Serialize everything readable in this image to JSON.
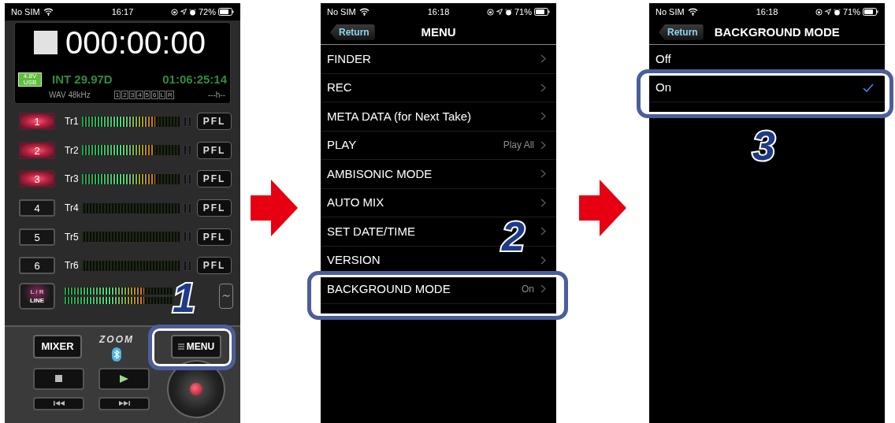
{
  "recorder_screen": {
    "status_bar": {
      "carrier": "No SIM",
      "time": "16:17",
      "battery": "72%"
    },
    "counter": "000:00:00",
    "power_badge": [
      "4.8V",
      "USB"
    ],
    "timecode_mode": "INT 29.97D",
    "timecode": "01:06:25:14",
    "file_format": "WAV 48kHz",
    "track_indicators": [
      "1",
      "2",
      "3",
      "4",
      "5",
      "6",
      "L",
      "R"
    ],
    "remaining_time": "---h--",
    "tracks": [
      {
        "number": "1",
        "label": "Tr1",
        "armed": true,
        "level": 0.75,
        "pfl": "PFL"
      },
      {
        "number": "2",
        "label": "Tr2",
        "armed": true,
        "level": 0.73,
        "pfl": "PFL"
      },
      {
        "number": "3",
        "label": "Tr3",
        "armed": true,
        "level": 0.75,
        "pfl": "PFL"
      },
      {
        "number": "4",
        "label": "Tr4",
        "armed": false,
        "level": 0,
        "pfl": "PFL"
      },
      {
        "number": "5",
        "label": "Tr5",
        "armed": false,
        "level": 0,
        "pfl": "PFL"
      },
      {
        "number": "6",
        "label": "Tr6",
        "armed": false,
        "level": 0,
        "pfl": "PFL"
      }
    ],
    "mix": {
      "label": "L / R",
      "sublabel": "LINE",
      "meters": [
        {
          "level": 0.73
        },
        {
          "level": 0.73
        }
      ]
    },
    "mixer_button": "MIXER",
    "logo": "ZOOM",
    "menu_button": "MENU"
  },
  "menu_screen": {
    "status_bar": {
      "carrier": "No SIM",
      "time": "16:18",
      "battery": "71%"
    },
    "back_button": "Return",
    "title": "MENU",
    "items": [
      {
        "label": "FINDER"
      },
      {
        "label": "REC"
      },
      {
        "label": "META DATA (for Next Take)"
      },
      {
        "label": "PLAY",
        "value": "Play All"
      },
      {
        "label": "AMBISONIC MODE"
      },
      {
        "label": "AUTO MIX"
      },
      {
        "label": "SET DATE/TIME"
      },
      {
        "label": "VERSION"
      },
      {
        "label": "BACKGROUND MODE",
        "value": "On"
      }
    ]
  },
  "background_mode_screen": {
    "status_bar": {
      "carrier": "No SIM",
      "time": "16:18",
      "battery": "71%"
    },
    "back_button": "Return",
    "title": "BACKGROUND MODE",
    "options": [
      {
        "label": "Off",
        "selected": false
      },
      {
        "label": "On",
        "selected": true
      }
    ]
  },
  "steps": [
    "1",
    "2",
    "3"
  ]
}
